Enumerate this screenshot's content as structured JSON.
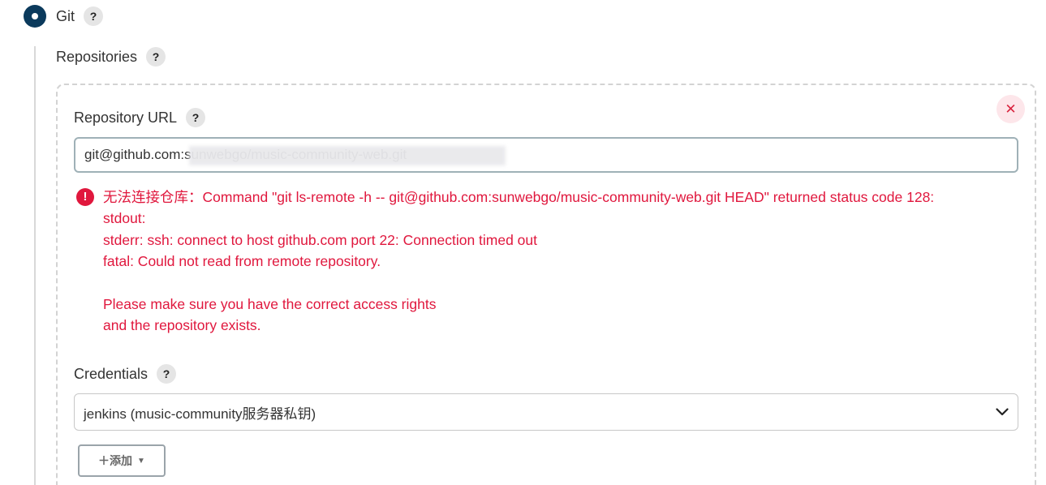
{
  "git": {
    "label": "Git",
    "help": "?"
  },
  "repositories": {
    "label": "Repositories",
    "help": "?"
  },
  "repository_url": {
    "label": "Repository URL",
    "help": "?",
    "value": "git@github.com:sunwebgo/music-community-web.git"
  },
  "error": {
    "icon": "!",
    "message": "无法连接仓库：Command \"git ls-remote -h -- git@github.com:sunwebgo/music-community-web.git HEAD\" returned status code 128:\nstdout:\nstderr: ssh: connect to host github.com port 22: Connection timed out\nfatal: Could not read from remote repository.\n\nPlease make sure you have the correct access rights\nand the repository exists."
  },
  "credentials": {
    "label": "Credentials",
    "help": "?",
    "selected": "jenkins (music-community服务器私钥)"
  },
  "add_button": {
    "label": "＋添加",
    "caret": "▼"
  },
  "close_button": {
    "label": "✕"
  },
  "colors": {
    "radio": "#0b3a5c",
    "error": "#e0173d",
    "close_bg": "#fde6ea"
  }
}
